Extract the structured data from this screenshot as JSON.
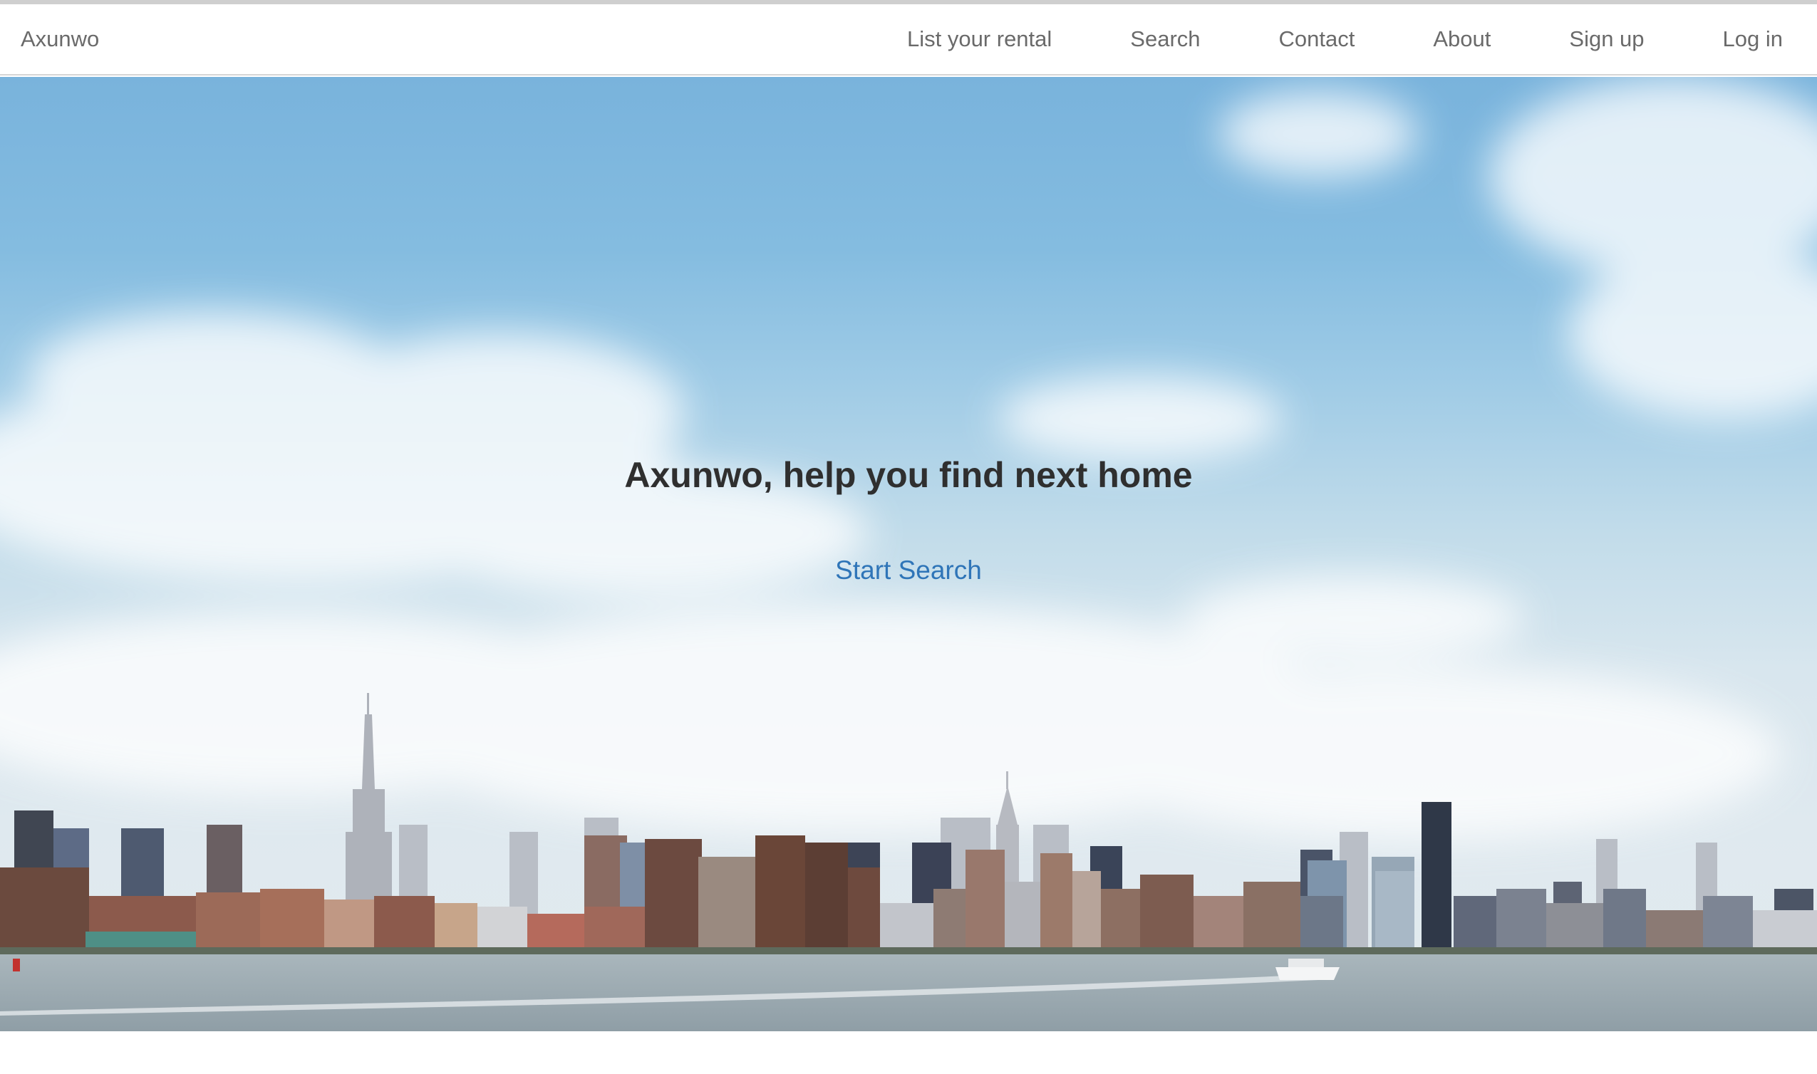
{
  "navbar": {
    "brand": "Axunwo",
    "links": [
      {
        "label": "List your rental"
      },
      {
        "label": "Search"
      },
      {
        "label": "Contact"
      },
      {
        "label": "About"
      },
      {
        "label": "Sign up"
      },
      {
        "label": "Log in"
      }
    ]
  },
  "hero": {
    "title": "Axunwo, help you find next home",
    "cta_label": "Start Search",
    "background": "city-skyline-photo"
  },
  "colors": {
    "link": "#2f75b8",
    "nav_text": "#6a6a6a",
    "title_text": "#2f2f2f"
  }
}
